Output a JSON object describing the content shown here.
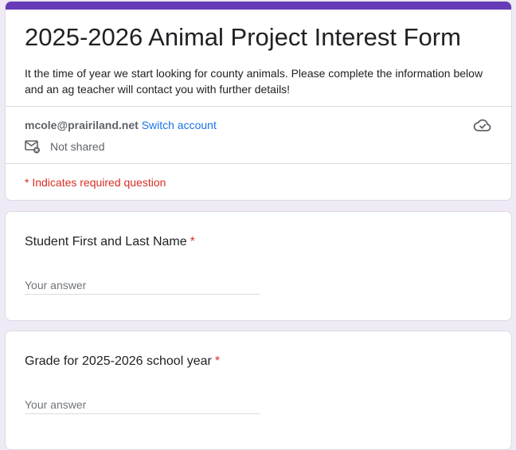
{
  "form": {
    "title": "2025-2026 Animal Project Interest Form",
    "description": "It the time of year we start looking for county animals. Please complete the information below and an ag teacher will contact you with further details!",
    "accent_color": "#673ab7",
    "background_color": "#efeaf6"
  },
  "account": {
    "email": "mcole@prairiland.net",
    "switch_label": "Switch account",
    "share_status": "Not shared",
    "share_icon": "mail-not-shared-icon",
    "save_icon": "cloud-check-icon"
  },
  "required_note": "* Indicates required question",
  "questions": [
    {
      "label": "Student First and Last Name",
      "required_marker": "*",
      "placeholder": "Your answer",
      "value": ""
    },
    {
      "label": "Grade for 2025-2026 school year",
      "required_marker": "*",
      "placeholder": "Your answer",
      "value": ""
    }
  ]
}
